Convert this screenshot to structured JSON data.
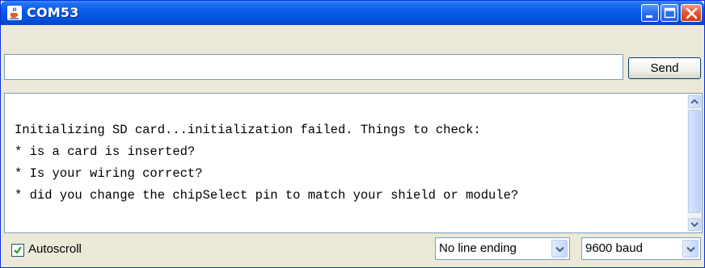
{
  "window": {
    "title": "COM53",
    "title_icon": "java-cup-icon",
    "controls": [
      "minimize-icon",
      "maximize-icon",
      "close-icon"
    ]
  },
  "input": {
    "value": "",
    "send_label": "Send"
  },
  "output": {
    "lines": [
      "Initializing SD card...initialization failed. Things to check:",
      "* is a card is inserted?",
      "* Is your wiring correct?",
      "* did you change the chipSelect pin to match your shield or module?"
    ]
  },
  "footer": {
    "autoscroll_label": "Autoscroll",
    "autoscroll_checked": true,
    "line_ending": "No line ending",
    "baud": "9600 baud"
  },
  "colors": {
    "titlebar": "#0a5ae6",
    "window_bg": "#ece9d8",
    "close_button": "#e45a36"
  }
}
